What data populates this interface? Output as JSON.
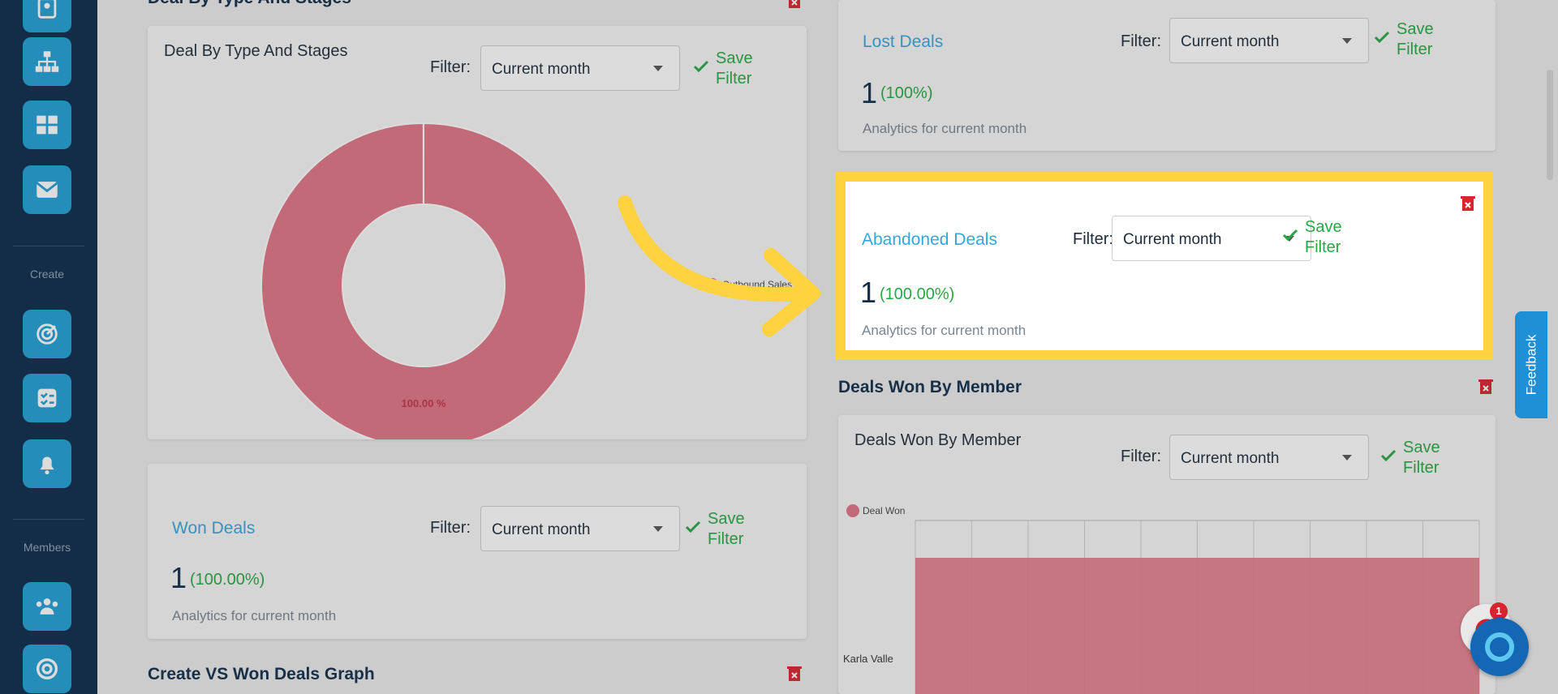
{
  "sidebar": {
    "create_label": "Create",
    "members_label": "Members",
    "buttons": [
      "contacts-icon",
      "org-chart-icon",
      "dashboard-icon",
      "mail-icon",
      "target-icon",
      "tasks-icon",
      "bell-icon",
      "team-icon",
      "goal-icon"
    ]
  },
  "filter_label": "Filter:",
  "filter_value": "Current month",
  "save_filter": "Save Filter",
  "analytics_text": "Analytics for current month",
  "left": {
    "section1_title": "Deal By Type And Stages",
    "panel1_title": "Deal By Type And Stages",
    "won_deals": {
      "title": "Won Deals",
      "count": "1",
      "percent": "(100.00%)"
    },
    "section2_title": "Create VS Won Deals Graph"
  },
  "right": {
    "lost_deals": {
      "title": "Lost Deals",
      "count": "1",
      "percent": "(100%)"
    },
    "abandoned_deals": {
      "title": "Abandoned Deals",
      "count": "1",
      "percent": "(100.00%)"
    },
    "section_title": "Deals Won By Member",
    "panel_title": "Deals Won By Member"
  },
  "feedback_label": "Feedback",
  "chat_badge": "1",
  "chart_data": [
    {
      "type": "pie",
      "title": "Deal By Type And Stages",
      "categories": [
        "Outbound Sales"
      ],
      "values": [
        100.0
      ],
      "data_labels": [
        "100.00 %"
      ],
      "legend": "right",
      "colors": [
        "#e07585"
      ]
    },
    {
      "type": "bar",
      "title": "Deals Won By Member",
      "series": [
        {
          "name": "Deal Won",
          "values": [
            1
          ]
        }
      ],
      "categories": [
        "Karla Valle"
      ],
      "legend": "top-left",
      "colors": [
        "#e07585"
      ]
    }
  ],
  "colors": {
    "sidebar": "#0b2a4a",
    "accent": "#1f9fd6",
    "link": "#33a7dc",
    "success": "#27a844",
    "highlight": "#ffd23f",
    "danger": "#d9232d"
  }
}
